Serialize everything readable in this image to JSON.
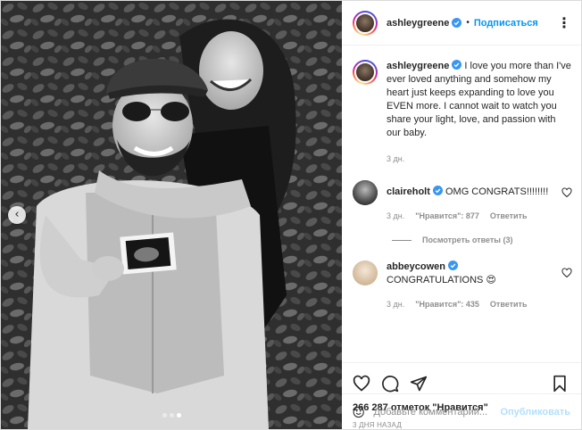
{
  "post": {
    "author": "ashleygreene",
    "follow_label": "Подписаться",
    "separator": "•",
    "more_label": "⋮",
    "caption_user": "ashleygreene",
    "caption_text": "I love you more than I've ever loved anything and somehow my heart just keeps expanding to love you EVEN more. I cannot wait to watch you share your light, love, and passion with our baby.",
    "caption_time": "3 дн.",
    "comments": [
      {
        "user": "claireholt",
        "text": "OMG CONGRATS!!!!!!!!",
        "time": "3 дн.",
        "likes": "\"Нравится\": 877",
        "reply": "Ответить"
      },
      {
        "user": "abbeycowen",
        "text": "CONGRATULATIONS 😍",
        "time": "3 дн.",
        "likes": "\"Нравится\": 435",
        "reply": "Ответить"
      }
    ],
    "view_replies": "Посмотреть ответы (3)",
    "likes_count": "266 287 отметок \"Нравится\"",
    "date": "3 дня назад",
    "comment_placeholder": "Добавьте комментарий...",
    "publish_label": "Опубликовать",
    "carousel": {
      "slides": 3,
      "active": 3
    }
  },
  "colors": {
    "accent": "#0095f6",
    "verified": "#3897f0",
    "muted": "#8e8e8e"
  },
  "icons": [
    "verified-icon",
    "heart-icon",
    "comment-icon",
    "share-icon",
    "bookmark-icon",
    "emoji-icon",
    "chevron-left-icon",
    "more-icon"
  ]
}
